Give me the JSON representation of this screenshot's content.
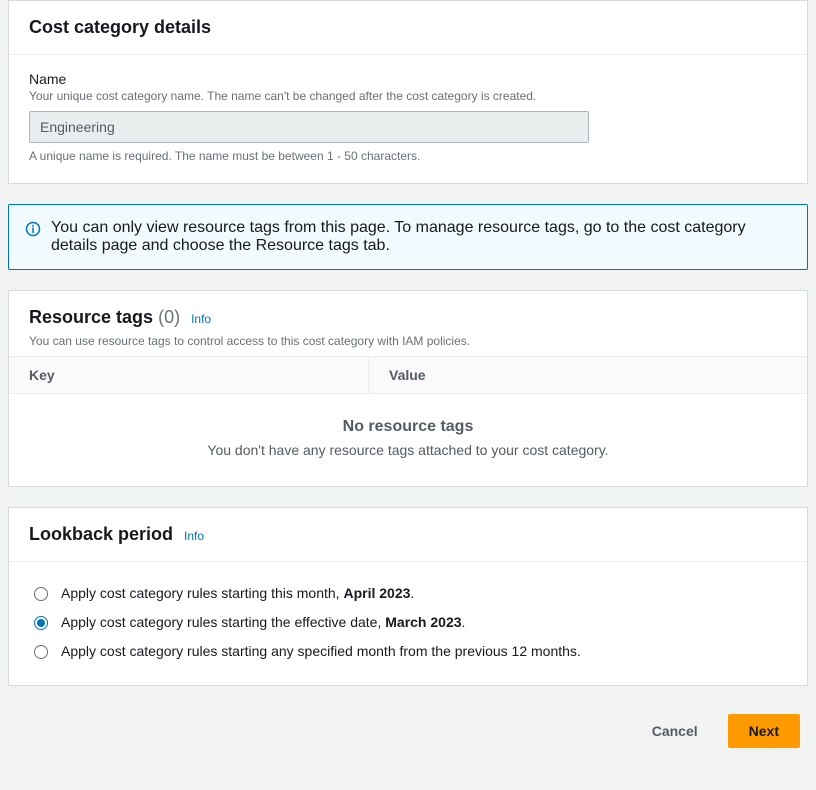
{
  "cost_category": {
    "title": "Cost category details",
    "name_label": "Name",
    "name_hint": "Your unique cost category name. The name can't be changed after the cost category is created.",
    "name_value": "Engineering",
    "name_constraint": "A unique name is required. The name must be between 1 - 50 characters."
  },
  "info_alert": {
    "text": "You can only view resource tags from this page. To manage resource tags, go to the cost category details page and choose the Resource tags tab."
  },
  "resource_tags": {
    "title": "Resource tags",
    "count": "(0)",
    "info_link": "Info",
    "subtext": "You can use resource tags to control access to this cost category with IAM policies.",
    "columns": {
      "key": "Key",
      "value": "Value"
    },
    "empty_title": "No resource tags",
    "empty_sub": "You don't have any resource tags attached to your cost category."
  },
  "lookback": {
    "title": "Lookback period",
    "info_link": "Info",
    "options": [
      {
        "prefix": "Apply cost category rules starting this month, ",
        "bold": "April 2023",
        "suffix": "."
      },
      {
        "prefix": "Apply cost category rules starting the effective date, ",
        "bold": "March 2023",
        "suffix": "."
      },
      {
        "prefix": "Apply cost category rules starting any specified month from the previous 12 months.",
        "bold": "",
        "suffix": ""
      }
    ],
    "selected_index": 1
  },
  "footer": {
    "cancel": "Cancel",
    "next": "Next"
  }
}
